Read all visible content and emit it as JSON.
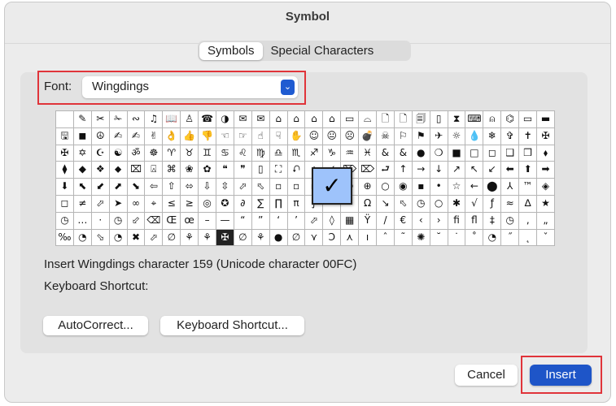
{
  "window": {
    "title": "Symbol"
  },
  "tabs": [
    {
      "label": "Symbols",
      "active": true
    },
    {
      "label": "Special Characters",
      "active": false
    }
  ],
  "font": {
    "label": "Font:",
    "value": "Wingdings"
  },
  "grid": [
    [
      "",
      "✎",
      "✂",
      "✁",
      "∾",
      "♫",
      "📖",
      "♙",
      "☎",
      "◑",
      "✉",
      "✉",
      "⌂",
      "⌂",
      "⌂",
      "⌂",
      "▭",
      "⌓",
      "🗋",
      "🗋",
      "🗐",
      "▯",
      "⧗",
      "⌨",
      "⍝",
      "⌬",
      "▭",
      "▬"
    ],
    [
      "🖫",
      "◼",
      "☮",
      "✍",
      "✍",
      "✌",
      "👌",
      "👍",
      "👎",
      "☜",
      "☞",
      "☝",
      "☟",
      "✋",
      "☺",
      "😐",
      "☹",
      "💣",
      "☠",
      "⚐",
      "⚑",
      "✈",
      "☼",
      "💧",
      "❄",
      "✞",
      "✝",
      "✠"
    ],
    [
      "✠",
      "✡",
      "☪",
      "☯",
      "ॐ",
      "☸",
      "♈",
      "♉",
      "♊",
      "♋",
      "♌",
      "♍",
      "♎",
      "♏",
      "♐",
      "♑",
      "♒",
      "♓",
      "&",
      "&",
      "●",
      "❍",
      "■",
      "□",
      "◻",
      "❑",
      "❒",
      "⬧"
    ],
    [
      "⧫",
      "◆",
      "❖",
      "⬥",
      "⌧",
      "⍓",
      "⌘",
      "❀",
      "✿",
      "❝",
      "❞",
      "▯",
      "⛶",
      "⮏",
      "⌂",
      "✓",
      "⌦",
      "⌦",
      "⮐",
      "↑",
      "→",
      "↓",
      "↗",
      "↖",
      "↙",
      "⬅",
      "⬆",
      "➡"
    ],
    [
      "⬇",
      "⬉",
      "⬋",
      "⬈",
      "⬊",
      "⇦",
      "⇧",
      "⬄",
      "⇩",
      "⇳",
      "⬀",
      "⬁",
      "▫",
      "▫",
      "▫",
      "◻",
      "⊗",
      "⊕",
      "○",
      "◉",
      "▪",
      "•",
      "☆",
      "←",
      "⬤",
      "⅄",
      "™",
      "◈"
    ],
    [
      "◻",
      "≠",
      "⬀",
      "➤",
      "∞",
      "⌖",
      "≤",
      "≥",
      "◎",
      "✪",
      "∂",
      "∑",
      "∏",
      "π",
      "∫",
      "ª",
      "º",
      "Ω",
      "↘",
      "⬁",
      "◷",
      "○",
      "✱",
      "√",
      "ƒ",
      "≈",
      "∆",
      "★"
    ],
    [
      "◷",
      "…",
      "·",
      "◷",
      "⬃",
      "⌫",
      "Œ",
      "œ",
      "–",
      "—",
      "“",
      "”",
      "‘",
      "’",
      "⬀",
      "◊",
      "▦",
      "Ÿ",
      "/",
      "€",
      "‹",
      "›",
      "ﬁ",
      "ﬂ",
      "‡",
      "◷",
      "‚",
      "„"
    ],
    [
      "‰",
      "◔",
      "⬂",
      "◔",
      "✖",
      "⬀",
      "∅",
      "⚘",
      "⚘",
      "✠",
      "∅",
      "⚘",
      "●",
      "∅",
      "⋎",
      "Ɔ",
      "⋏",
      "ı",
      "ˆ",
      "˜",
      "✺",
      "˘",
      "˙",
      "˚",
      "◔",
      "˝",
      "˛",
      "ˇ"
    ]
  ],
  "selected_symbol": "✓",
  "info_text": "Insert Wingdings character 159  (Unicode character 00FC)",
  "shortcut_label": "Keyboard Shortcut:",
  "buttons": {
    "autocorrect": "AutoCorrect...",
    "keyboard_shortcut": "Keyboard Shortcut...",
    "cancel": "Cancel",
    "insert": "Insert"
  },
  "colors": {
    "accent": "#1e55c8",
    "highlight": "#e0343a",
    "selected_cell": "#9ec3fb"
  }
}
